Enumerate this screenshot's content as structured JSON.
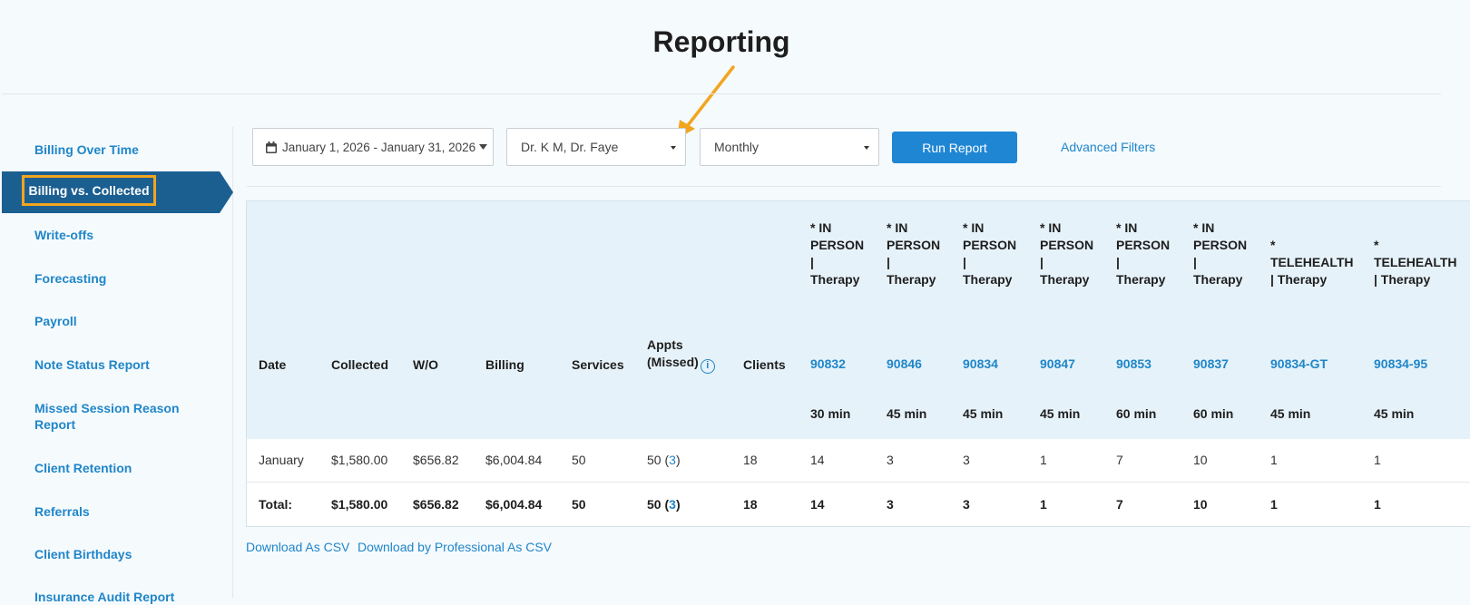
{
  "page": {
    "title": "Reporting"
  },
  "sidebar": {
    "items": [
      {
        "label": "Billing Over Time"
      },
      {
        "label": "Billing vs. Collected",
        "active": true
      },
      {
        "label": "Write-offs"
      },
      {
        "label": "Forecasting"
      },
      {
        "label": "Payroll"
      },
      {
        "label": "Note Status Report"
      },
      {
        "label": "Missed Session Reason Report"
      },
      {
        "label": "Client Retention"
      },
      {
        "label": "Referrals"
      },
      {
        "label": "Client Birthdays"
      },
      {
        "label": "Insurance Audit Report"
      }
    ]
  },
  "filters": {
    "date_range": "January 1, 2026 - January 31, 2026",
    "professionals": "Dr. K M, Dr. Faye",
    "interval": "Monthly",
    "run_label": "Run Report",
    "advanced_label": "Advanced Filters"
  },
  "table": {
    "headers": {
      "date": "Date",
      "collected": "Collected",
      "wo": "W/O",
      "billing": "Billing",
      "services": "Services",
      "appts_line1": "Appts",
      "appts_line2": "(Missed)",
      "clients": "Clients"
    },
    "service_columns": [
      {
        "type": "* IN PERSON | Therapy",
        "code": "90832",
        "duration": "30 min"
      },
      {
        "type": "* IN PERSON | Therapy",
        "code": "90846",
        "duration": "45 min"
      },
      {
        "type": "* IN PERSON | Therapy",
        "code": "90834",
        "duration": "45 min"
      },
      {
        "type": "* IN PERSON | Therapy",
        "code": "90847",
        "duration": "45 min"
      },
      {
        "type": "* IN PERSON | Therapy",
        "code": "90853",
        "duration": "60 min"
      },
      {
        "type": "* IN PERSON | Therapy",
        "code": "90837",
        "duration": "60 min"
      },
      {
        "type": "* TELEHEALTH | Therapy",
        "code": "90834-GT",
        "duration": "45 min"
      },
      {
        "type": "* TELEHEALTH | Therapy",
        "code": "90834-95",
        "duration": "45 min"
      }
    ],
    "rows": [
      {
        "date": "January",
        "collected": "$1,580.00",
        "wo": "$656.82",
        "billing": "$6,004.84",
        "services": "50",
        "appts": "50",
        "missed": "3",
        "clients": "18",
        "counts": [
          "14",
          "3",
          "3",
          "1",
          "7",
          "10",
          "1",
          "1"
        ]
      }
    ],
    "total": {
      "label": "Total:",
      "collected": "$1,580.00",
      "wo": "$656.82",
      "billing": "$6,004.84",
      "services": "50",
      "appts": "50",
      "missed": "3",
      "clients": "18",
      "counts": [
        "14",
        "3",
        "3",
        "1",
        "7",
        "10",
        "1",
        "1"
      ]
    }
  },
  "downloads": {
    "csv": "Download As CSV",
    "by_professional_csv": "Download by Professional As CSV"
  },
  "colors": {
    "accent": "#1f86c9",
    "active_nav": "#1b5f91",
    "highlight": "#f2a51e"
  }
}
